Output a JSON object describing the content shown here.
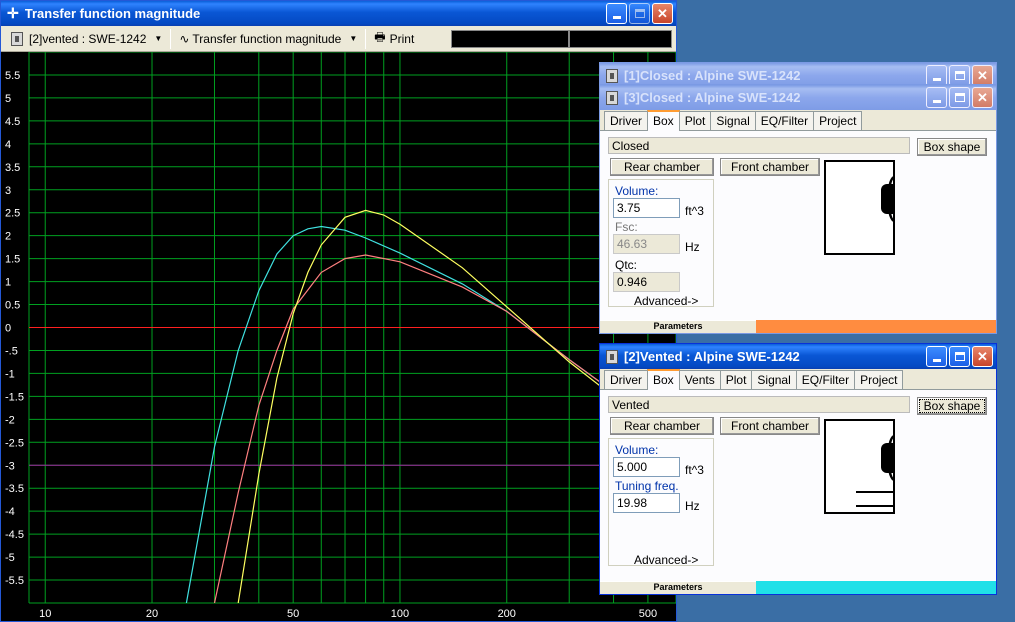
{
  "main_window": {
    "title": "Transfer function magnitude",
    "toolbar": {
      "driver_select": "[2]vented : SWE-1242",
      "plot_select": "Transfer function magnitude",
      "print_label": "Print"
    }
  },
  "chart_data": {
    "type": "line",
    "xscale": "log",
    "xlim": [
      9,
      600
    ],
    "ylim": [
      -6,
      6
    ],
    "x_ticks": [
      10,
      20,
      50,
      100,
      200,
      500
    ],
    "y_ticks": [
      "5.5",
      "5",
      "4.5",
      "4",
      "3.5",
      "3",
      "2.5",
      "2",
      "1.5",
      "1",
      "0.5",
      "0",
      "-.5",
      "-1",
      "-1.5",
      "-2",
      "-2.5",
      "-3",
      "-3.5",
      "-4",
      "-4.5",
      "-5",
      "-5.5"
    ],
    "grid": true,
    "reference_lines": [
      {
        "y": 0,
        "color": "#ff2020"
      },
      {
        "y": -3,
        "color": "#a020a0"
      }
    ],
    "series": [
      {
        "color": "#40e0e0",
        "points": [
          [
            25,
            -6
          ],
          [
            30,
            -2.6
          ],
          [
            35,
            -0.5
          ],
          [
            40,
            0.8
          ],
          [
            45,
            1.6
          ],
          [
            50,
            2.0
          ],
          [
            55,
            2.15
          ],
          [
            60,
            2.2
          ],
          [
            70,
            2.12
          ],
          [
            80,
            1.95
          ],
          [
            100,
            1.62
          ],
          [
            150,
            0.95
          ],
          [
            200,
            0.35
          ],
          [
            300,
            -0.7
          ],
          [
            400,
            -1.4
          ],
          [
            500,
            -2.0
          ],
          [
            600,
            -2.5
          ]
        ]
      },
      {
        "color": "#ff8080",
        "points": [
          [
            30,
            -6
          ],
          [
            35,
            -3.6
          ],
          [
            40,
            -1.7
          ],
          [
            45,
            -0.5
          ],
          [
            50,
            0.4
          ],
          [
            60,
            1.2
          ],
          [
            70,
            1.5
          ],
          [
            80,
            1.58
          ],
          [
            100,
            1.43
          ],
          [
            150,
            0.88
          ],
          [
            200,
            0.35
          ],
          [
            300,
            -0.7
          ],
          [
            400,
            -1.4
          ],
          [
            500,
            -2.0
          ],
          [
            600,
            -2.5
          ]
        ]
      },
      {
        "color": "#ffff60",
        "points": [
          [
            35,
            -6
          ],
          [
            40,
            -3.2
          ],
          [
            45,
            -1.1
          ],
          [
            50,
            0.3
          ],
          [
            55,
            1.2
          ],
          [
            60,
            1.8
          ],
          [
            70,
            2.4
          ],
          [
            80,
            2.55
          ],
          [
            90,
            2.45
          ],
          [
            100,
            2.25
          ],
          [
            150,
            1.3
          ],
          [
            200,
            0.45
          ],
          [
            300,
            -0.75
          ],
          [
            400,
            -1.5
          ],
          [
            500,
            -2.1
          ],
          [
            600,
            -2.6
          ]
        ]
      }
    ]
  },
  "win1": {
    "title": "[1]Closed : Alpine SWE-1242"
  },
  "win3": {
    "title": "[3]Closed : Alpine SWE-1242",
    "tabs": [
      "Driver",
      "Box",
      "Plot",
      "Signal",
      "EQ/Filter",
      "Project"
    ],
    "box_type": "Closed",
    "box_shape_button": "Box shape",
    "rear_chamber": "Rear chamber",
    "front_chamber": "Front chamber",
    "volume_label": "Volume:",
    "volume_value": "3.75",
    "volume_unit": "ft^3",
    "fsc_label": "Fsc:",
    "fsc_value": "46.63",
    "fsc_unit": "Hz",
    "qtc_label": "Qtc:",
    "qtc_value": "0.946",
    "advanced": "Advanced->",
    "status": "Parameters",
    "status_color": "#ff8c40"
  },
  "win2": {
    "title": "[2]Vented : Alpine SWE-1242",
    "tabs": [
      "Driver",
      "Box",
      "Vents",
      "Plot",
      "Signal",
      "EQ/Filter",
      "Project"
    ],
    "box_type": "Vented",
    "box_shape_button": "Box shape",
    "rear_chamber": "Rear chamber",
    "front_chamber": "Front chamber",
    "volume_label": "Volume:",
    "volume_value": "5.000",
    "volume_unit": "ft^3",
    "tuning_label": "Tuning freq.",
    "tuning_value": "19.98",
    "tuning_unit": "Hz",
    "advanced": "Advanced->",
    "status": "Parameters",
    "status_color": "#20e0e8"
  }
}
